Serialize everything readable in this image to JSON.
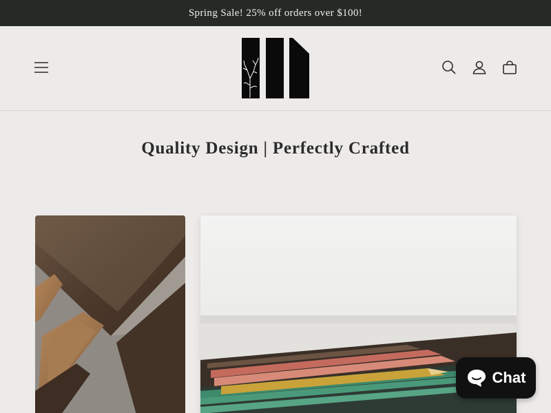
{
  "announcement": {
    "text": "Spring Sale! 25% off orders over $100!"
  },
  "header": {
    "menu_icon": "hamburger-menu-icon",
    "logo_icon": "brand-logo",
    "search_icon": "search-icon",
    "account_icon": "account-icon",
    "cart_icon": "cart-icon"
  },
  "hero": {
    "tagline": "Quality Design | Perfectly Crafted"
  },
  "collection": {
    "cards": [
      {
        "image": "walnut-wood-trays-photo"
      },
      {
        "image": "pencils-on-wooden-tray-photo"
      }
    ]
  },
  "chat": {
    "label": "Chat",
    "icon": "chat-bubble-icon",
    "color": "#111111"
  },
  "colors": {
    "announcement_bg": "#252a26",
    "page_bg": "#edebe9"
  }
}
